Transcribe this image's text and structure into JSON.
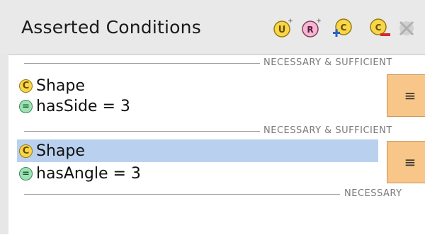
{
  "header": {
    "title": "Asserted Conditions"
  },
  "toolbar": {
    "icons": [
      "add-individual-icon",
      "add-restriction-icon",
      "add-class-icon",
      "remove-class-icon",
      "delete-icon"
    ]
  },
  "sections": [
    {
      "label": "NECESSARY & SUFFICIENT",
      "rows": [
        {
          "badge": "C",
          "text": "Shape"
        },
        {
          "badge": "=",
          "text": "hasSide = 3"
        }
      ],
      "button": "≡"
    },
    {
      "label": "NECESSARY & SUFFICIENT",
      "rows": [
        {
          "badge": "C",
          "text": "Shape"
        },
        {
          "badge": "=",
          "text": "hasAngle = 3"
        }
      ],
      "button": "≡"
    },
    {
      "label": "NECESSARY",
      "rows": []
    }
  ],
  "colors": {
    "selected_row": "#b9d1ee",
    "equivalent_button": "#f8c688",
    "class_badge": "#f7d64a",
    "restriction_badge": "#9ee2b4"
  }
}
